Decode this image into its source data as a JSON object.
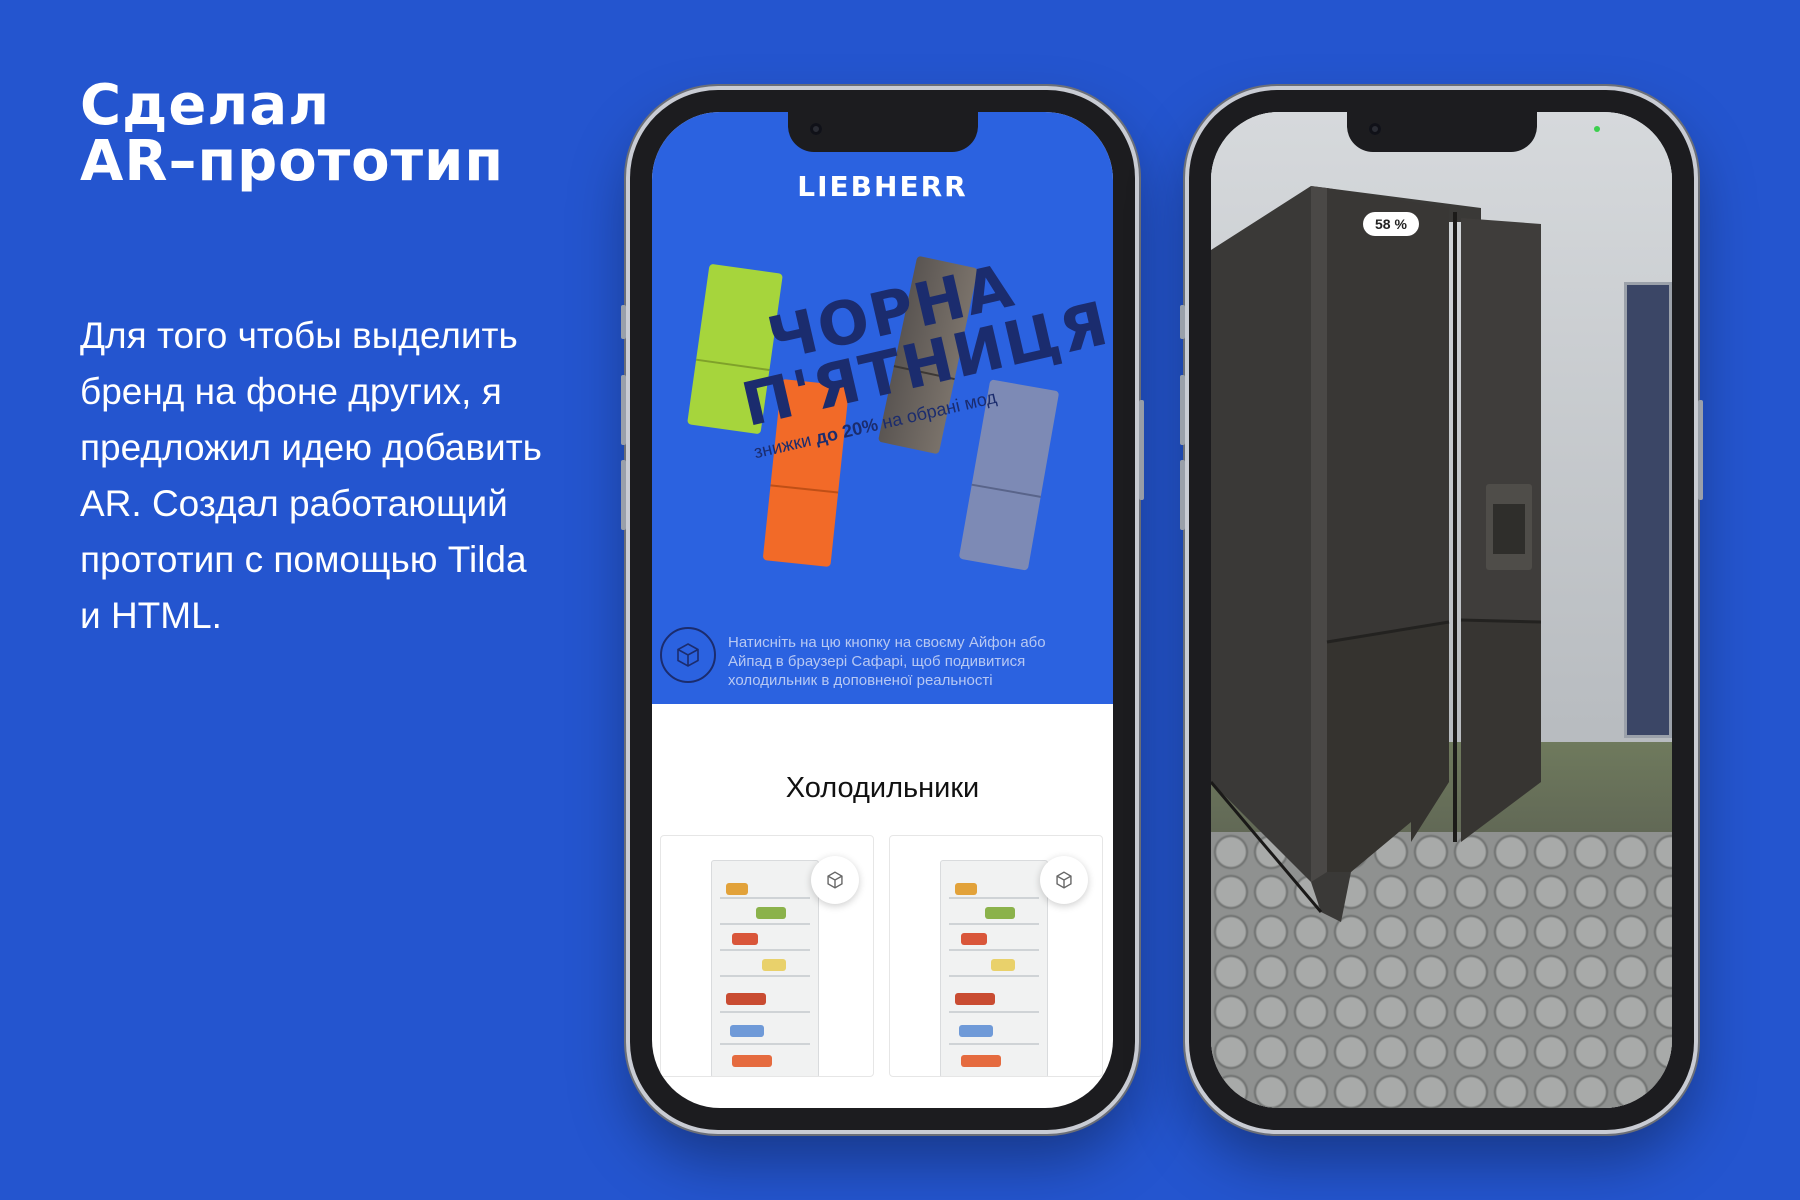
{
  "heading": {
    "line1": "Сделал",
    "line2": "AR–прототип"
  },
  "description": "Для того чтобы выделить бренд на фоне других, я предложил идею добавить AR. Создал работающий прототип с помощью Tilda и HTML.",
  "phone1": {
    "brand": "LIEBHERR",
    "promo": {
      "line1": "ЧОРНА",
      "line2": "П'ЯТНИЦЯ",
      "discount_prefix": "знижки ",
      "discount_bold": "до 20%",
      "discount_suffix": " на обрані мод"
    },
    "ar_hint": "Натисніть на цю кнопку на своєму Айфон або Айпад в браузері Сафарі, щоб подивитися холодильник в доповненої реальності",
    "section_title": "Холодильники",
    "products": [
      {
        "icon": "ar-view-icon"
      },
      {
        "icon": "ar-view-icon"
      }
    ],
    "colors": {
      "hero_bg": "#2b62e0",
      "promo_text": "#1b2c6e"
    }
  },
  "phone2": {
    "progress_badge": "58 %",
    "progress_value": 58
  },
  "colors": {
    "background": "#2455cf"
  }
}
